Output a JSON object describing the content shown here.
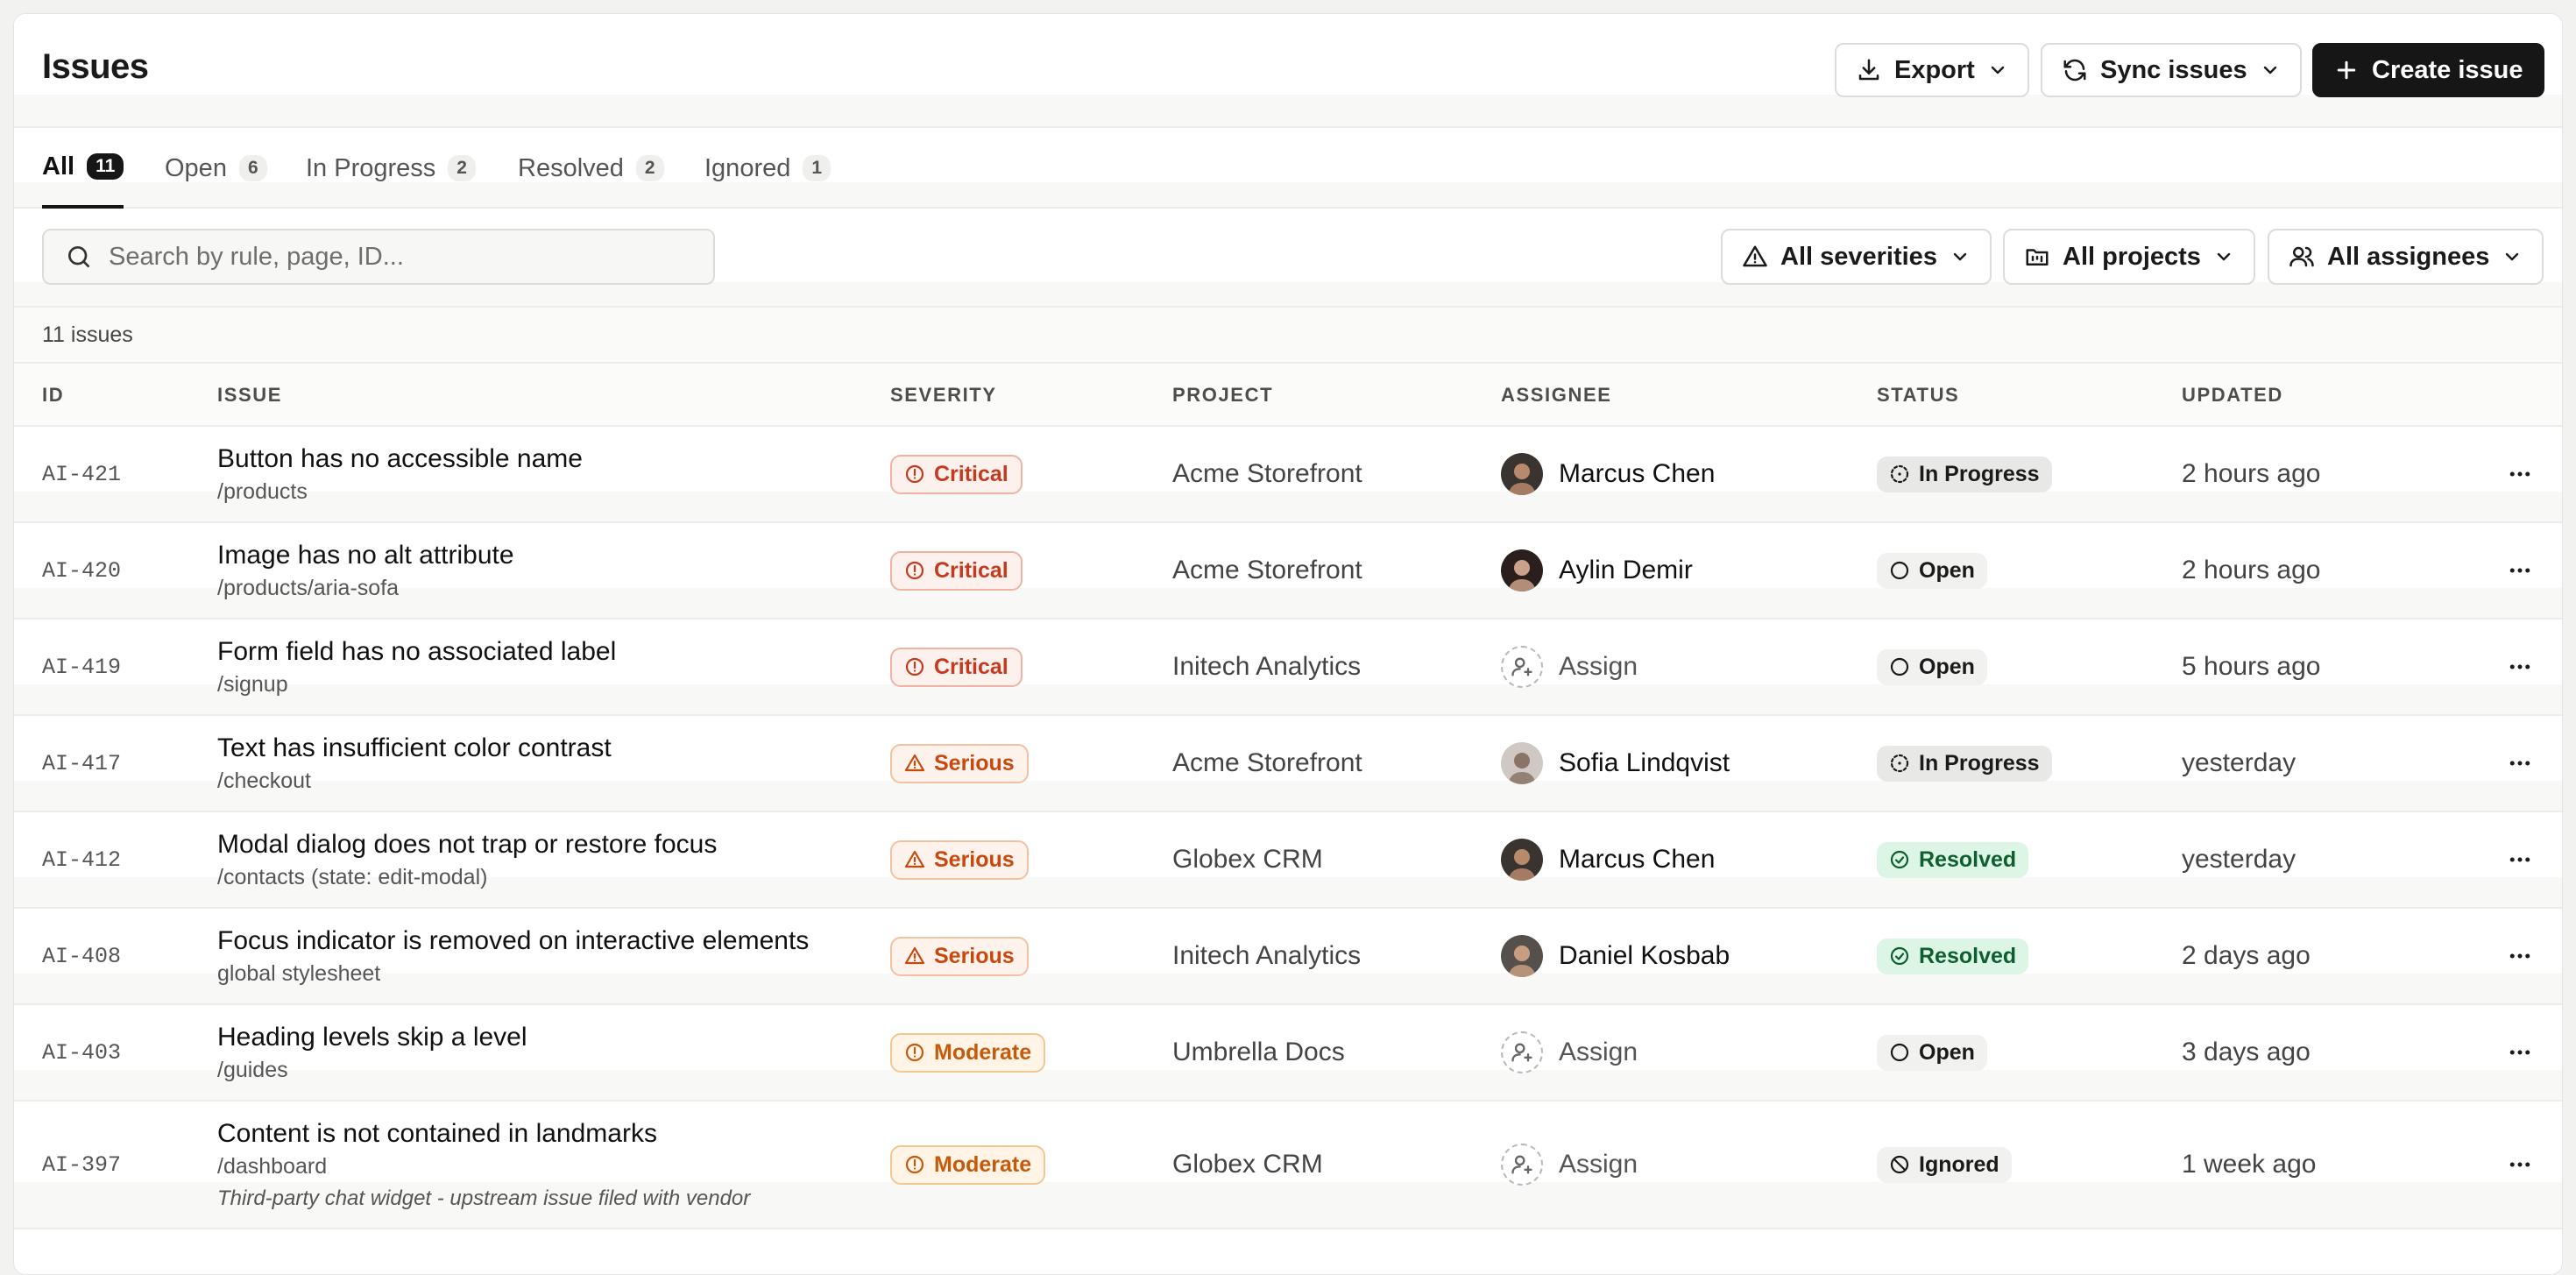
{
  "header": {
    "title": "Issues",
    "export_label": "Export",
    "sync_label": "Sync issues",
    "create_label": "Create issue"
  },
  "tabs": [
    {
      "label": "All",
      "count": "11"
    },
    {
      "label": "Open",
      "count": "6"
    },
    {
      "label": "In Progress",
      "count": "2"
    },
    {
      "label": "Resolved",
      "count": "2"
    },
    {
      "label": "Ignored",
      "count": "1"
    }
  ],
  "filters": {
    "search_placeholder": "Search by rule, page, ID...",
    "severity_label": "All severities",
    "project_label": "All projects",
    "assignee_label": "All assignees"
  },
  "summary": {
    "count_text": "11 issues"
  },
  "table": {
    "columns": [
      "ID",
      "ISSUE",
      "SEVERITY",
      "PROJECT",
      "ASSIGNEE",
      "STATUS",
      "UPDATED"
    ],
    "rows": [
      {
        "id": "AI-421",
        "title": "Button has no accessible name",
        "page": "/products",
        "severity": "Critical",
        "project": "Acme Storefront",
        "assignee": "Marcus Chen",
        "status": "In Progress",
        "updated": "2 hours ago"
      },
      {
        "id": "AI-420",
        "title": "Image has no alt attribute",
        "page": "/products/aria-sofa",
        "severity": "Critical",
        "project": "Acme Storefront",
        "assignee": "Aylin Demir",
        "status": "Open",
        "updated": "2 hours ago"
      },
      {
        "id": "AI-419",
        "title": "Form field has no associated label",
        "page": "/signup",
        "severity": "Critical",
        "project": "Initech Analytics",
        "assignee": "Assign",
        "status": "Open",
        "updated": "5 hours ago"
      },
      {
        "id": "AI-417",
        "title": "Text has insufficient color contrast",
        "page": "/checkout",
        "severity": "Serious",
        "project": "Acme Storefront",
        "assignee": "Sofia Lindqvist",
        "status": "In Progress",
        "updated": "yesterday"
      },
      {
        "id": "AI-412",
        "title": "Modal dialog does not trap or restore focus",
        "page": "/contacts (state: edit-modal)",
        "severity": "Serious",
        "project": "Globex CRM",
        "assignee": "Marcus Chen",
        "status": "Resolved",
        "updated": "yesterday"
      },
      {
        "id": "AI-408",
        "title": "Focus indicator is removed on interactive elements",
        "page": "global stylesheet",
        "severity": "Serious",
        "project": "Initech Analytics",
        "assignee": "Daniel Kosbab",
        "status": "Resolved",
        "updated": "2 days ago"
      },
      {
        "id": "AI-403",
        "title": "Heading levels skip a level",
        "page": "/guides",
        "severity": "Moderate",
        "project": "Umbrella Docs",
        "assignee": "Assign",
        "status": "Open",
        "updated": "3 days ago"
      },
      {
        "id": "AI-397",
        "title": "Content is not contained in landmarks",
        "page": "/dashboard",
        "note": "Third-party chat widget - upstream issue filed with vendor",
        "severity": "Moderate",
        "project": "Globex CRM",
        "assignee": "Assign",
        "status": "Ignored",
        "updated": "1 week ago"
      }
    ]
  },
  "colors": {
    "primary": "#161616",
    "critical": "#c53a1e",
    "serious": "#c9480e",
    "moderate": "#c65a0c",
    "resolved_bg": "#dcf5e4"
  }
}
